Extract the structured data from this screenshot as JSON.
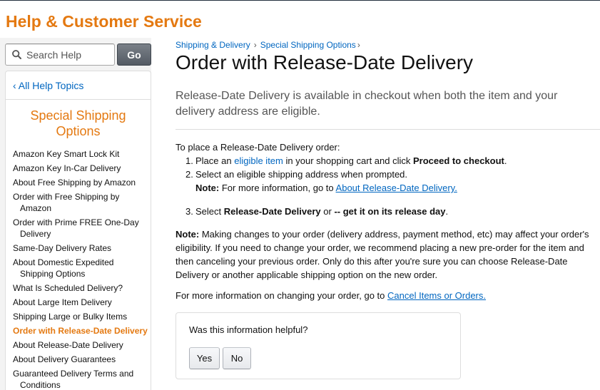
{
  "header": {
    "title": "Help & Customer Service"
  },
  "search": {
    "placeholder": "Search Help",
    "value": "",
    "go_label": "Go"
  },
  "sidebar": {
    "all_topics": "‹ All Help Topics",
    "heading": "Special Shipping Options",
    "items": [
      {
        "label": "Amazon Key Smart Lock Kit"
      },
      {
        "label": "Amazon Key In-Car Delivery"
      },
      {
        "label": "About Free Shipping by Amazon"
      },
      {
        "label": "Order with Free Shipping by Amazon"
      },
      {
        "label": "Order with Prime FREE One-Day Delivery"
      },
      {
        "label": "Same-Day Delivery Rates"
      },
      {
        "label": "About Domestic Expedited Shipping Options"
      },
      {
        "label": "What Is Scheduled Delivery?"
      },
      {
        "label": "About Large Item Delivery"
      },
      {
        "label": "Shipping Large or Bulky Items"
      },
      {
        "label": "Order with Release-Date Delivery",
        "active": true
      },
      {
        "label": "About Release-Date Delivery"
      },
      {
        "label": "About Delivery Guarantees"
      },
      {
        "label": "Guaranteed Delivery Terms and Conditions"
      }
    ]
  },
  "breadcrumb": {
    "level1": "Shipping & Delivery",
    "separator": "›",
    "level2": "Special Shipping Options"
  },
  "main": {
    "title": "Order with Release-Date Delivery",
    "intro": "Release-Date Delivery is available in checkout when both the item and your delivery address are eligible.",
    "lead": "To place a Release-Date Delivery order:",
    "step1": {
      "num": "1.",
      "pre": "Place an",
      "link": "eligible item",
      "mid": "in your shopping cart and click",
      "bold": "Proceed to checkout",
      "post": "."
    },
    "step2": {
      "num": "2.",
      "text": "Select an eligible shipping address when prompted.",
      "note_label": "Note:",
      "note_text": "For more information, go to",
      "note_link": "About Release-Date Delivery."
    },
    "step3": {
      "num": "3.",
      "pre": "Select",
      "bold1": "Release-Date Delivery",
      "mid": "or",
      "bold2": "-- get it on its release day",
      "post": "."
    },
    "note": {
      "label": "Note:",
      "text": "Making changes to your order (delivery address, payment method, etc) may affect your order's eligibility. If you need to change your order, we recommend placing a new pre-order for the item and then canceling your previous order. Only do this after you're sure you can choose Release-Date Delivery or another applicable shipping option on the new order."
    },
    "more": {
      "text": "For more information on changing your order, go to",
      "link": "Cancel Items or Orders."
    }
  },
  "feedback": {
    "question": "Was this information helpful?",
    "yes": "Yes",
    "no": "No"
  },
  "colors": {
    "brand": "#e47911",
    "link": "#0066c0",
    "header_line": "#232f3e",
    "band": "#f3f3f3"
  },
  "icons": {
    "search": "search-icon"
  }
}
